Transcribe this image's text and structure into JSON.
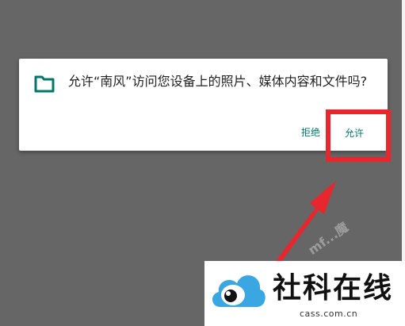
{
  "dialog": {
    "message": "允许“南风”访问您设备上的照片、媒体内容和文件吗?",
    "deny_label": "拒绝",
    "allow_label": "允许"
  },
  "icons": {
    "dialog_icon": "folder-icon",
    "logo_icon": "cloud-eye-icon"
  },
  "annotation": {
    "highlight_color": "#e8262d",
    "arrow_color": "#e8262d"
  },
  "watermarks": {
    "faint_text": "mf...魔"
  },
  "logo": {
    "name": "社科在线",
    "url": "cass.com.cn"
  },
  "colors": {
    "backdrop": "#666666",
    "accent": "#00796b"
  }
}
